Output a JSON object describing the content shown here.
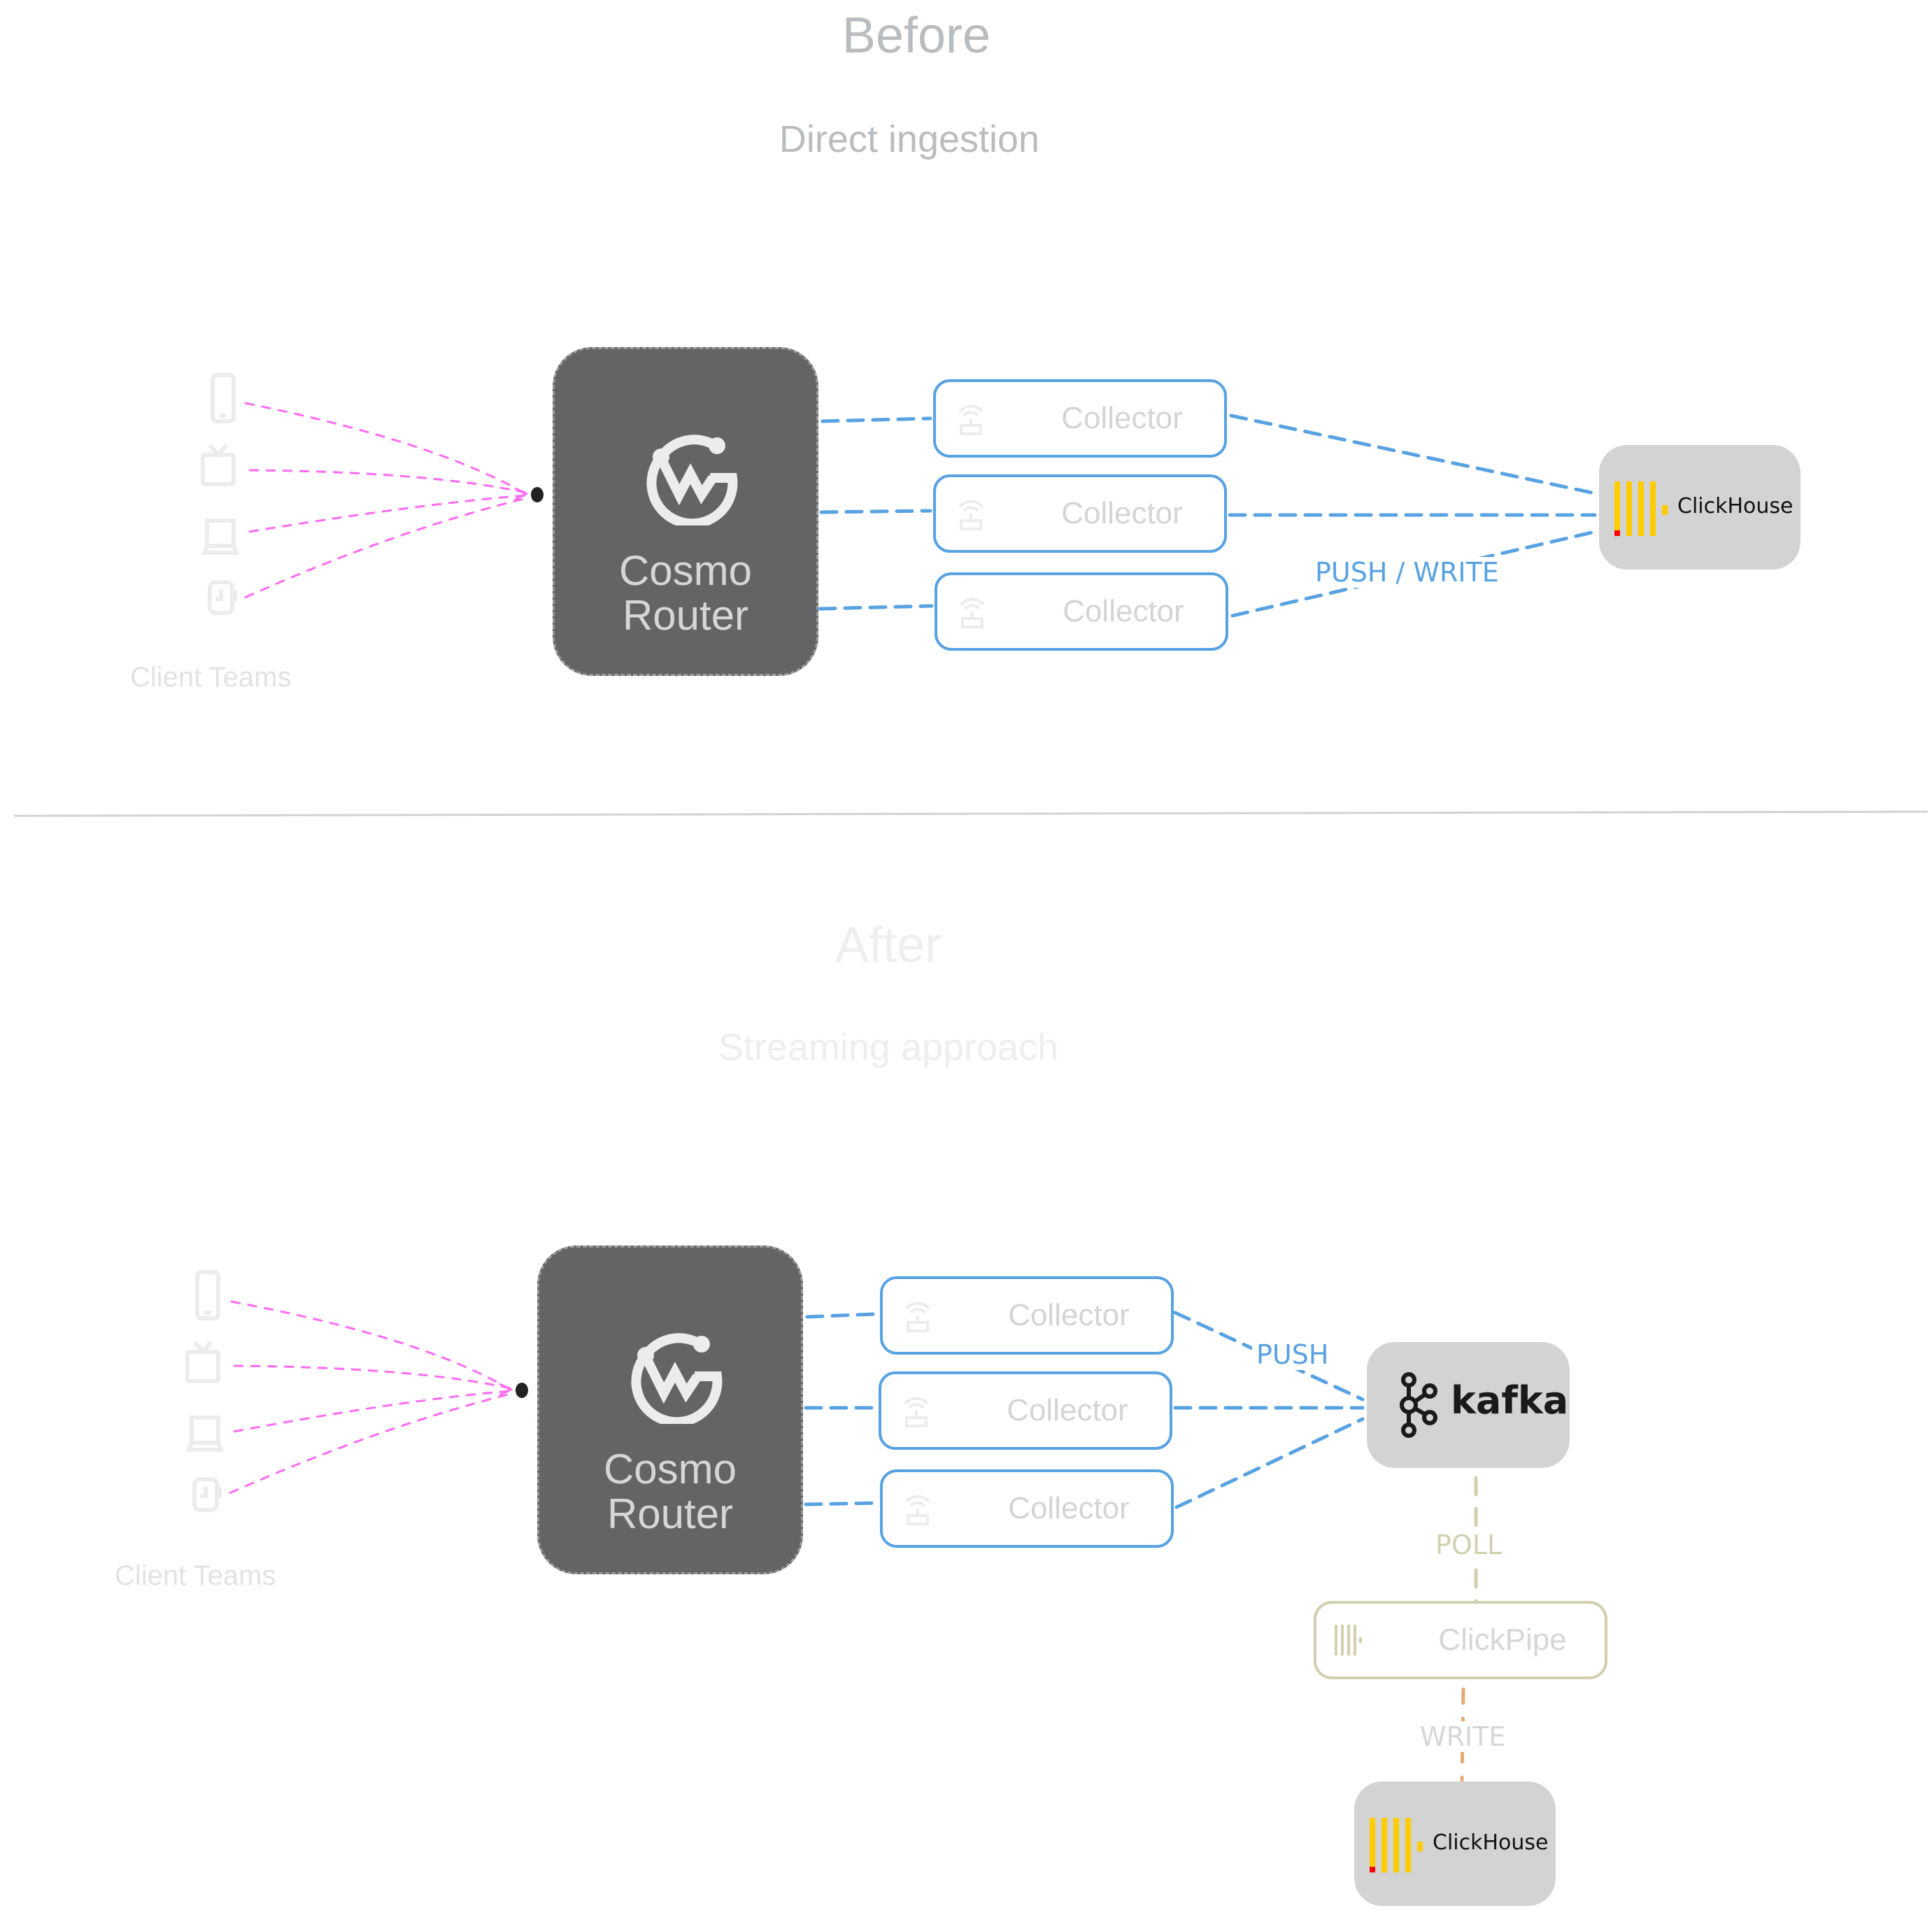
{
  "colors": {
    "collector_border": "#58a2e2",
    "push_line": "#58a2e2",
    "client_line": "#ff6cf0",
    "poll_line": "#d1cfaf",
    "write_line": "#e3aa74",
    "router_fill": "#636466",
    "store_fill": "#d3d3d3",
    "clickhouse_yellow": "#ffcc00",
    "clickhouse_red": "#ff0000"
  },
  "before": {
    "title": "Before",
    "subtitle": "Direct ingestion",
    "clients": {
      "label": "Client Teams",
      "devices": [
        "phone-icon",
        "tv-icon",
        "laptop-icon",
        "watch-icon"
      ]
    },
    "router": {
      "line1": "Cosmo",
      "line2": "Router",
      "icon": "wundergraph-logo-icon"
    },
    "collectors": [
      {
        "label": "Collector",
        "icon": "wifi-router-icon"
      },
      {
        "label": "Collector",
        "icon": "wifi-router-icon"
      },
      {
        "label": "Collector",
        "icon": "wifi-router-icon"
      }
    ],
    "edge_label": "PUSH / WRITE",
    "sink": {
      "label": "ClickHouse",
      "icon": "clickhouse-logo-icon"
    }
  },
  "after": {
    "title": "After",
    "subtitle": "Streaming approach",
    "clients": {
      "label": "Client Teams",
      "devices": [
        "phone-icon",
        "tv-icon",
        "laptop-icon",
        "watch-icon"
      ]
    },
    "router": {
      "line1": "Cosmo",
      "line2": "Router",
      "icon": "wundergraph-logo-icon"
    },
    "collectors": [
      {
        "label": "Collector",
        "icon": "wifi-router-icon"
      },
      {
        "label": "Collector",
        "icon": "wifi-router-icon"
      },
      {
        "label": "Collector",
        "icon": "wifi-router-icon"
      }
    ],
    "push_label": "PUSH",
    "broker": {
      "label": "kafka",
      "icon": "kafka-logo-icon"
    },
    "poll_label": "POLL",
    "pipe": {
      "label": "ClickPipe",
      "icon": "clickpipe-icon"
    },
    "write_label": "WRITE",
    "sink": {
      "label": "ClickHouse",
      "icon": "clickhouse-logo-icon"
    }
  }
}
